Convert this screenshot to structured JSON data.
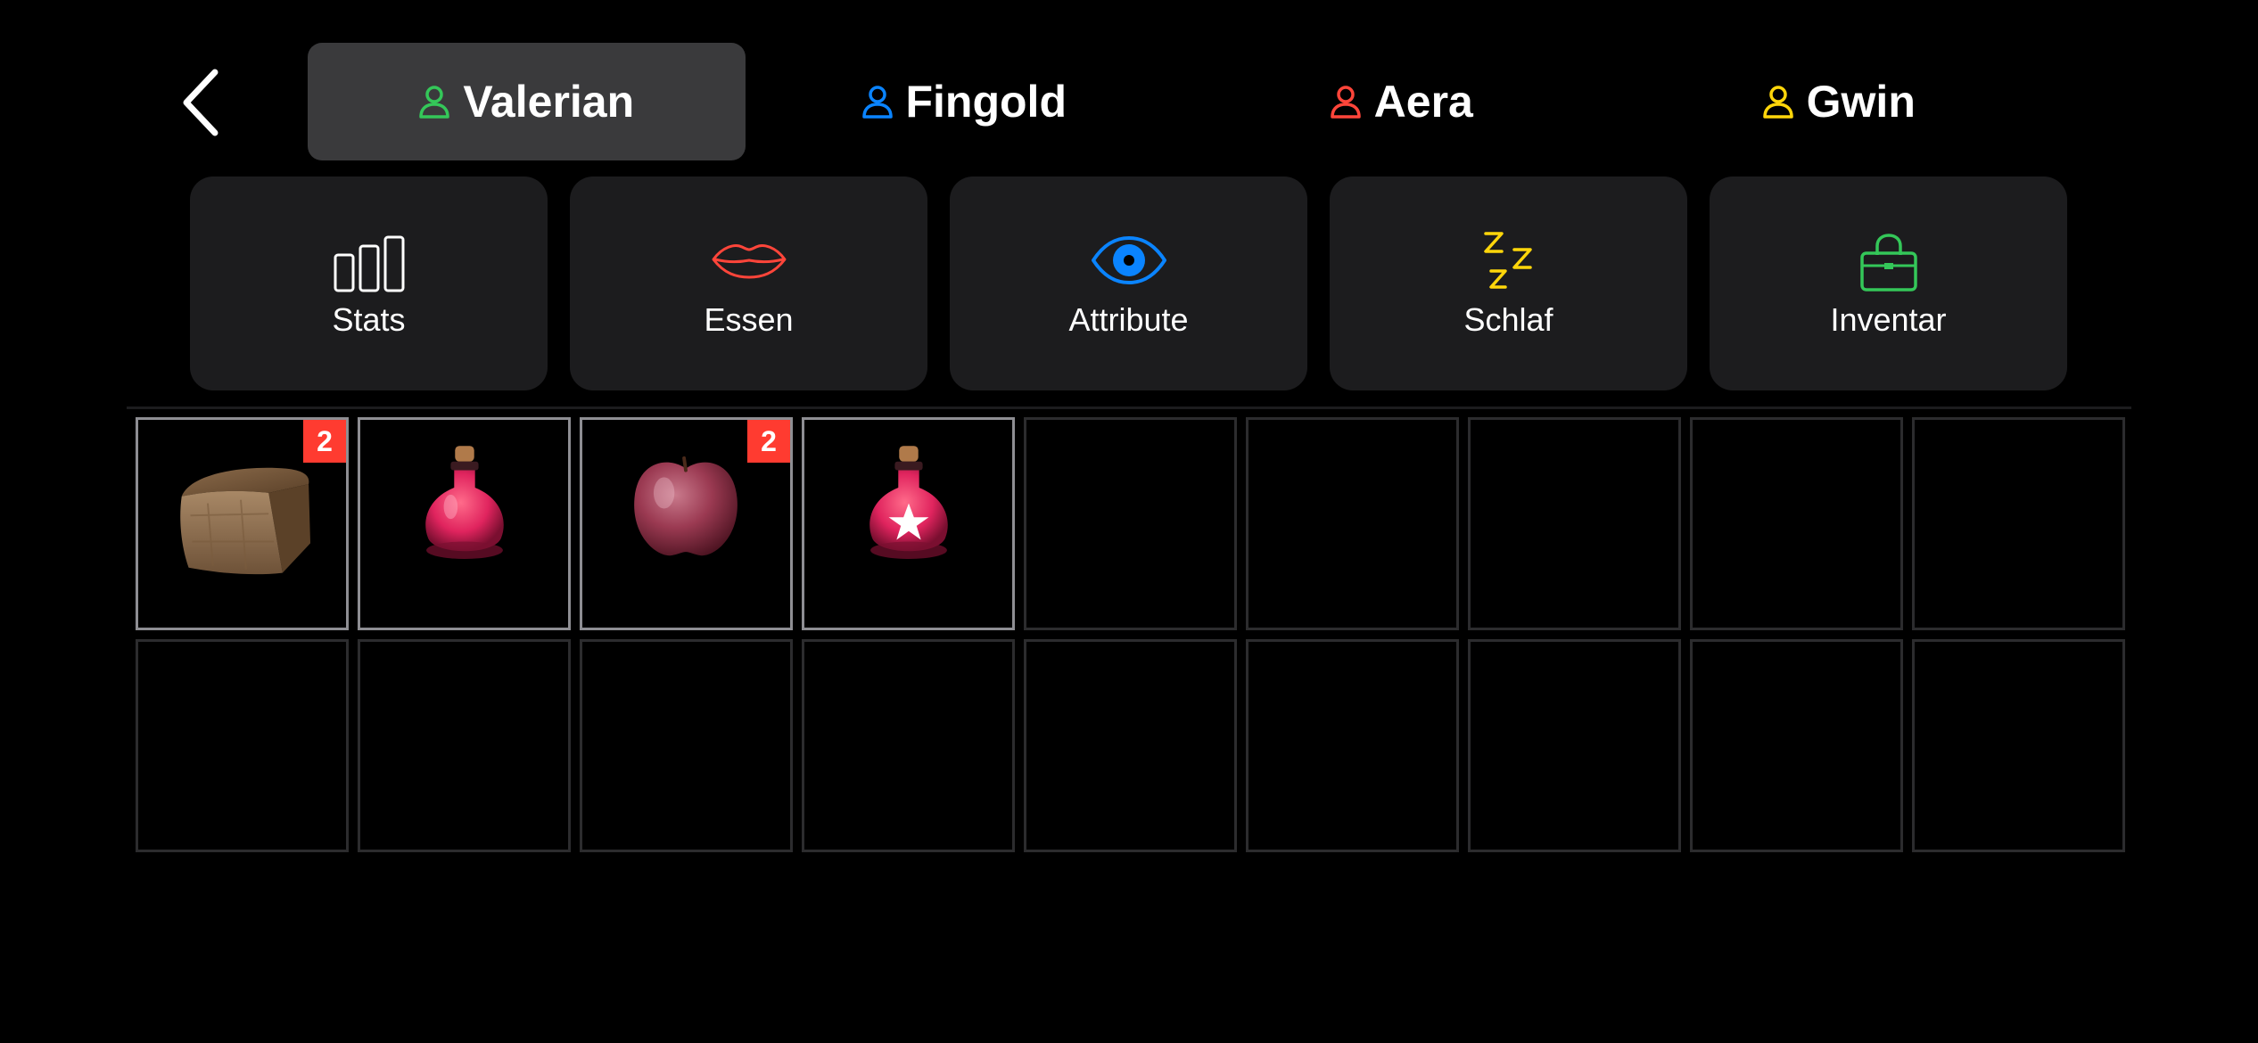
{
  "colors": {
    "background": "#000000",
    "tile": "#1c1c1e",
    "tab_active": "#3a3a3c",
    "badge": "#ff3b30",
    "green": "#34c759",
    "blue": "#0a84ff",
    "red": "#ff453a",
    "yellow": "#ffd60a"
  },
  "nav": {
    "back_icon": "chevron-left-icon"
  },
  "characters": [
    {
      "name": "Valerian",
      "icon": "person-icon",
      "color": "#34c759",
      "active": true
    },
    {
      "name": "Fingold",
      "icon": "person-icon",
      "color": "#0a84ff",
      "active": false
    },
    {
      "name": "Aera",
      "icon": "person-icon",
      "color": "#ff453a",
      "active": false
    },
    {
      "name": "Gwin",
      "icon": "person-icon",
      "color": "#ffd60a",
      "active": false
    }
  ],
  "categories": [
    {
      "label": "Stats",
      "icon": "bar-chart-icon",
      "color": "#ffffff"
    },
    {
      "label": "Essen",
      "icon": "lips-icon",
      "color": "#ff453a"
    },
    {
      "label": "Attribute",
      "icon": "eye-icon",
      "color": "#0a84ff"
    },
    {
      "label": "Schlaf",
      "icon": "sleep-zzz-icon",
      "color": "#ffd60a"
    },
    {
      "label": "Inventar",
      "icon": "handbag-icon",
      "color": "#34c759"
    }
  ],
  "inventory": {
    "slots": [
      {
        "item": "bread",
        "count": "2"
      },
      {
        "item": "red-potion",
        "count": ""
      },
      {
        "item": "apple",
        "count": "2"
      },
      {
        "item": "red-star-potion",
        "count": ""
      },
      {
        "item": "",
        "count": ""
      },
      {
        "item": "",
        "count": ""
      },
      {
        "item": "",
        "count": ""
      },
      {
        "item": "",
        "count": ""
      },
      {
        "item": "",
        "count": ""
      },
      {
        "item": "",
        "count": ""
      },
      {
        "item": "",
        "count": ""
      },
      {
        "item": "",
        "count": ""
      },
      {
        "item": "",
        "count": ""
      },
      {
        "item": "",
        "count": ""
      },
      {
        "item": "",
        "count": ""
      },
      {
        "item": "",
        "count": ""
      },
      {
        "item": "",
        "count": ""
      },
      {
        "item": "",
        "count": ""
      }
    ]
  }
}
